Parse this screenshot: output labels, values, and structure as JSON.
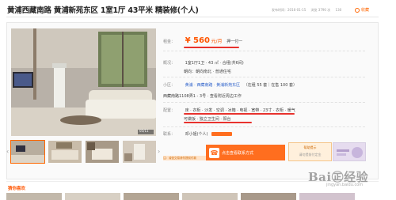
{
  "listing": {
    "title": "黄浦西藏南路 黄浦新苑东区 1室1厅 43平米 精装修(个人)",
    "meta": {
      "posted": "发布时间：2016-01-15",
      "views": "浏览 3790 次",
      "id": "130"
    },
    "favorite_label": "收藏"
  },
  "info": {
    "rent_label": "租金：",
    "price": "¥ 560",
    "price_unit": "元/月",
    "payment": "押一付一",
    "type_label": "概况：",
    "type_value": "1室1厅1卫 · 43 ㎡ · 合租(共6间)",
    "orientation": "朝向：朝向南北 · 普通住宅",
    "community_label": "小区：",
    "community_value": "黄浦 · 西藏南路 · 黄浦新苑东区",
    "community_stats": "（在租 55 套｜在售 100 套）",
    "address": "西藏南路1108弄1 - 3号 · 查看附近周边工作",
    "config_label": "配置：",
    "config_line1": "床 · 衣柜 · 沙发 · 空调 · 冰箱 · 电视 · 宽带 · 23寸 · 衣柜 · 暖气",
    "config_line2": "可做饭 · 独立卫生间 · 阳台",
    "contact_label": "联系：",
    "contact_value": "邓小姐(个人)"
  },
  "actions": {
    "contact_button": "点击查看联系方式",
    "help_title": "帮助提示",
    "help_tip": "请勿提前付定金",
    "warn_text": "注：诚信交易请勿提前付款"
  },
  "photo": {
    "counter": "05/11"
  },
  "recommend": {
    "title": "猜你喜欢"
  },
  "watermark": {
    "brand": "Bai㊣经验",
    "sub": "jingyan.baidu.com"
  },
  "colors": {
    "accent": "#ff5500",
    "contact_button": "#ff6e1f",
    "annotation_underline": "#e8322d",
    "link": "#3366cc"
  }
}
